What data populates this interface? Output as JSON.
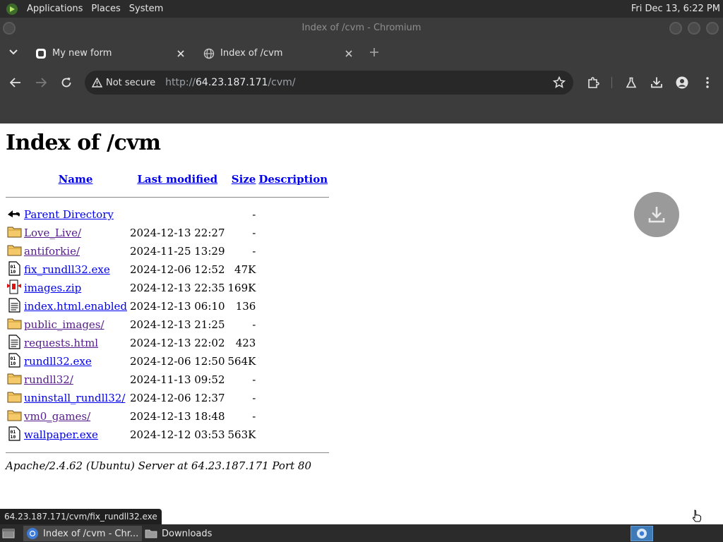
{
  "panel": {
    "applications": "Applications",
    "places": "Places",
    "system": "System",
    "clock": "Fri Dec 13,  6:22 PM"
  },
  "window": {
    "title": "Index of /cvm - Chromium"
  },
  "tabs": [
    {
      "title": "My new form",
      "active": true
    },
    {
      "title": "Index of /cvm",
      "active": false
    }
  ],
  "toolbar": {
    "security_label": "Not secure",
    "url_scheme": "http://",
    "url_host": "64.23.187.171",
    "url_path": "/cvm/"
  },
  "page": {
    "heading": "Index of /cvm",
    "columns": {
      "name": "Name",
      "modified": "Last modified",
      "size": "Size",
      "description": "Description"
    },
    "rows": [
      {
        "icon": "back-icon",
        "name": "Parent Directory",
        "modified": "",
        "size": "-",
        "visited": false
      },
      {
        "icon": "folder-icon",
        "name": "Love_Live/",
        "modified": "2024-12-13 22:27",
        "size": "-",
        "visited": true
      },
      {
        "icon": "folder-icon",
        "name": "antiforkie/",
        "modified": "2024-11-25 13:29",
        "size": "-",
        "visited": true
      },
      {
        "icon": "binary-icon",
        "name": "fix_rundll32.exe",
        "modified": "2024-12-06 12:52",
        "size": "47K",
        "visited": false
      },
      {
        "icon": "compressed-icon",
        "name": "images.zip",
        "modified": "2024-12-13 22:35",
        "size": "169K",
        "visited": false
      },
      {
        "icon": "text-icon",
        "name": "index.html.enabled",
        "modified": "2024-12-13 06:10",
        "size": "136",
        "visited": false
      },
      {
        "icon": "folder-icon",
        "name": "public_images/",
        "modified": "2024-12-13 21:25",
        "size": "-",
        "visited": true
      },
      {
        "icon": "text-icon",
        "name": "requests.html",
        "modified": "2024-12-13 22:02",
        "size": "423",
        "visited": true
      },
      {
        "icon": "binary-icon",
        "name": "rundll32.exe",
        "modified": "2024-12-06 12:50",
        "size": "564K",
        "visited": false
      },
      {
        "icon": "folder-icon",
        "name": "rundll32/",
        "modified": "2024-11-13 09:52",
        "size": "-",
        "visited": true
      },
      {
        "icon": "folder-icon",
        "name": "uninstall_rundll32/",
        "modified": "2024-12-06 12:37",
        "size": "-",
        "visited": false
      },
      {
        "icon": "folder-icon",
        "name": "vm0_games/",
        "modified": "2024-12-13 18:48",
        "size": "-",
        "visited": true
      },
      {
        "icon": "binary-icon",
        "name": "wallpaper.exe",
        "modified": "2024-12-12 03:53",
        "size": "563K",
        "visited": false
      }
    ],
    "footer": "Apache/2.4.62 (Ubuntu) Server at 64.23.187.171 Port 80"
  },
  "status_url": "64.23.187.171/cvm/fix_rundll32.exe",
  "taskbar": {
    "tasks": [
      {
        "label": "Index of /cvm - Chr...",
        "icon": "chromium-icon",
        "active": true
      },
      {
        "label": "Downloads",
        "icon": "folder-icon",
        "active": false
      }
    ]
  },
  "colors": {
    "link": "#0000ee",
    "visited": "#551a8b",
    "chrome_bg": "#3c3c3c",
    "omnibox_bg": "#282828",
    "panel_bg": "#2b2b2b"
  }
}
